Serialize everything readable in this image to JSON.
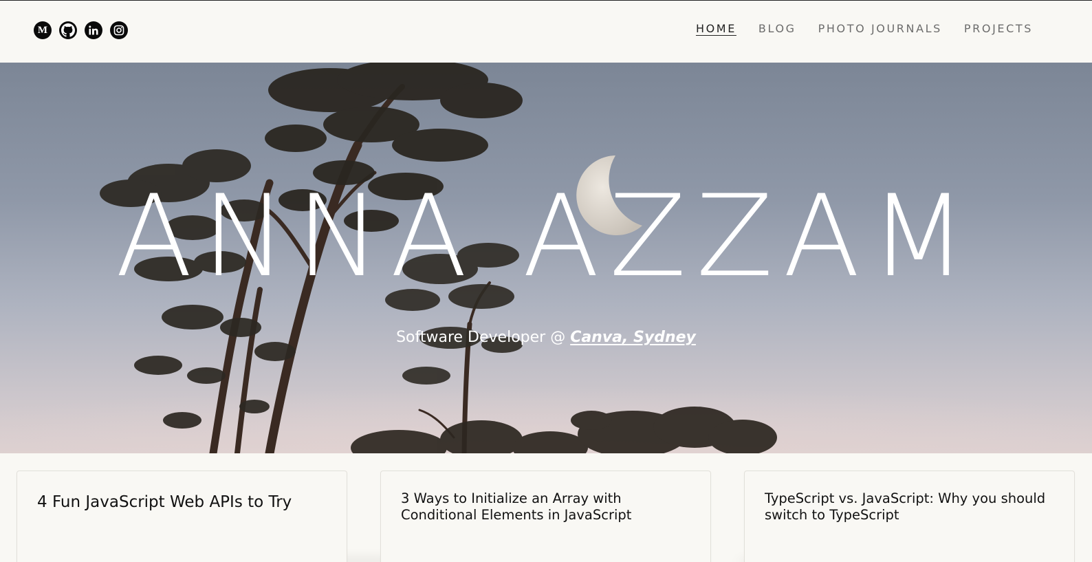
{
  "header": {
    "socials": [
      {
        "name": "medium",
        "icon": "medium-icon"
      },
      {
        "name": "github",
        "icon": "github-icon"
      },
      {
        "name": "linkedin",
        "icon": "linkedin-icon"
      },
      {
        "name": "instagram",
        "icon": "instagram-icon"
      }
    ],
    "nav": {
      "home": "HOME",
      "blog": "BLOG",
      "photo_journals": "PHOTO JOURNALS",
      "projects": "PROJECTS",
      "active": "home"
    }
  },
  "hero": {
    "title": "ANNA AZZAM",
    "subtitle_prefix": "Software Developer @ ",
    "company": "Canva, Sydney"
  },
  "cards": [
    {
      "title": "4 Fun JavaScript Web APIs to Try"
    },
    {
      "title": "3 Ways to Initialize an Array with Conditional Elements in JavaScript"
    },
    {
      "title": "TypeScript vs. JavaScript: Why you should switch to TypeScript"
    }
  ],
  "colors": {
    "background": "#f9f8f4",
    "nav_text": "#6c6c6c",
    "nav_active": "#222222",
    "hero_text": "#ffffff",
    "sky": "#8f98a8"
  }
}
